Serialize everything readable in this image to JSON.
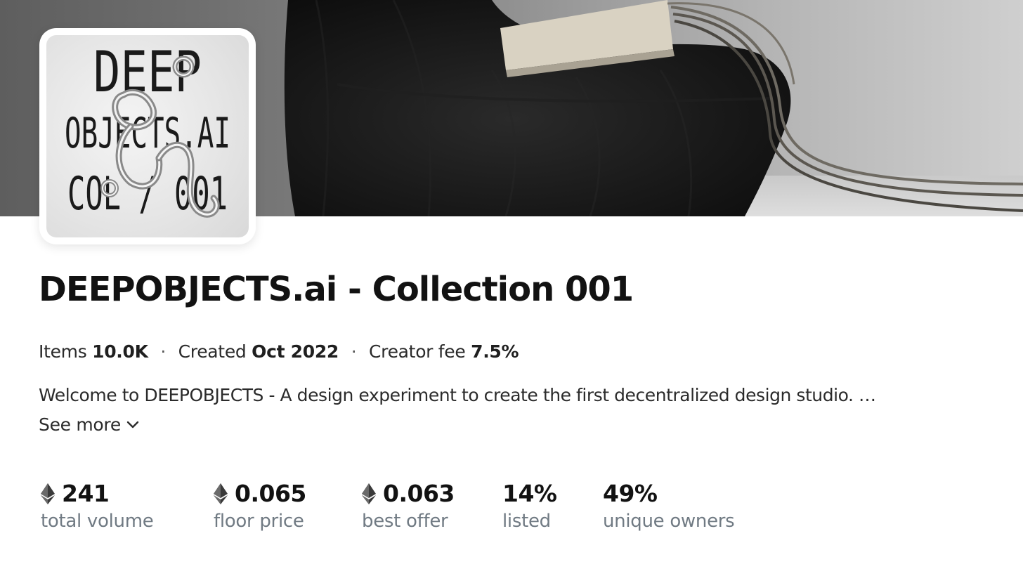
{
  "banner": {
    "description": "banner image"
  },
  "avatar": {
    "line1": "DEEP",
    "line2": "OBJECTS.AI",
    "line3": "COL / 001"
  },
  "collection": {
    "title": "DEEPOBJECTS.ai - Collection 001"
  },
  "meta": {
    "items_label": "Items",
    "items_value": "10.0K",
    "created_label": "Created",
    "created_value": "Oct 2022",
    "fee_label": "Creator fee",
    "fee_value": "7.5%",
    "separator": "·"
  },
  "description": {
    "text": "Welcome to DEEPOBJECTS - A design experiment to create the first decentralized design studio.  …",
    "see_more_label": "See more"
  },
  "stats": [
    {
      "value": "241",
      "label": "total volume",
      "eth": true
    },
    {
      "value": "0.065",
      "label": "floor price",
      "eth": true
    },
    {
      "value": "0.063",
      "label": "best offer",
      "eth": true
    },
    {
      "value": "14%",
      "label": "listed",
      "eth": false
    },
    {
      "value": "49%",
      "label": "unique owners",
      "eth": false
    }
  ],
  "colors": {
    "text_primary": "#121212",
    "text_secondary": "#707a83",
    "background": "#ffffff"
  },
  "icons": {
    "eth": "ethereum-icon",
    "chevron": "chevron-down-icon"
  }
}
